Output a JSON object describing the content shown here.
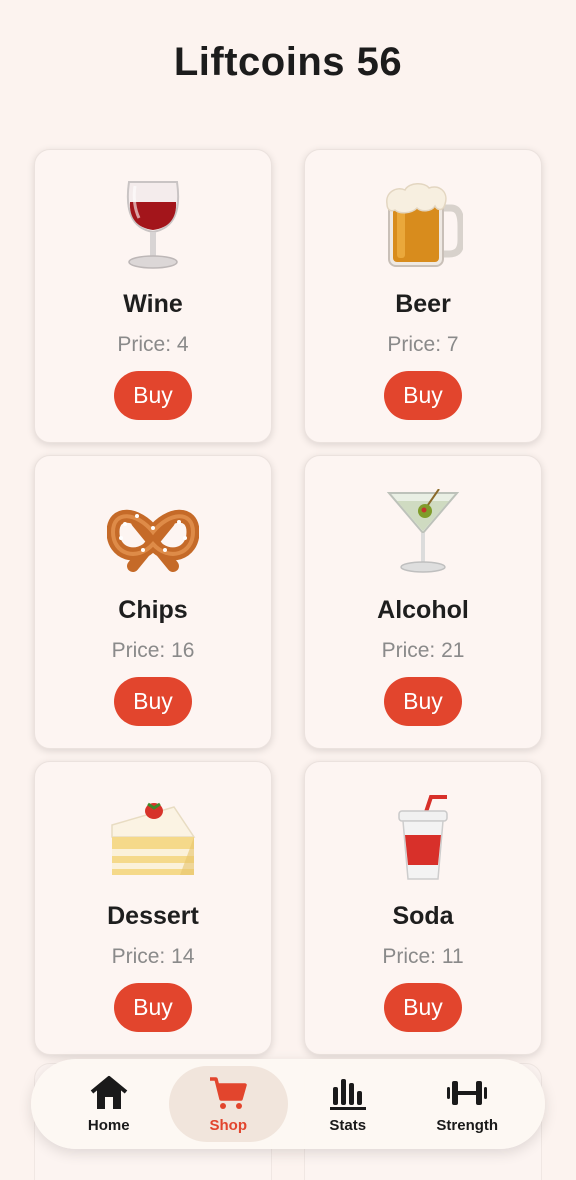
{
  "header": {
    "title": "Liftcoins 56"
  },
  "items": [
    {
      "name": "Wine",
      "price": "Price: 4",
      "buy": "Buy",
      "icon": "wine-glass-icon"
    },
    {
      "name": "Beer",
      "price": "Price: 7",
      "buy": "Buy",
      "icon": "beer-mug-icon"
    },
    {
      "name": "Chips",
      "price": "Price: 16",
      "buy": "Buy",
      "icon": "pretzel-icon"
    },
    {
      "name": "Alcohol",
      "price": "Price: 21",
      "buy": "Buy",
      "icon": "cocktail-glass-icon"
    },
    {
      "name": "Dessert",
      "price": "Price: 14",
      "buy": "Buy",
      "icon": "cake-icon"
    },
    {
      "name": "Soda",
      "price": "Price: 11",
      "buy": "Buy",
      "icon": "cup-with-straw-icon"
    }
  ],
  "nav": {
    "items": [
      {
        "label": "Home",
        "icon": "home-icon"
      },
      {
        "label": "Shop",
        "icon": "cart-icon"
      },
      {
        "label": "Stats",
        "icon": "bar-chart-icon"
      },
      {
        "label": "Strength",
        "icon": "dumbbell-icon"
      }
    ],
    "active": "Shop"
  },
  "colors": {
    "accent": "#e2452d",
    "background": "#fcf3ef",
    "card": "#fdf5f2",
    "muted": "#8a8a8a"
  }
}
